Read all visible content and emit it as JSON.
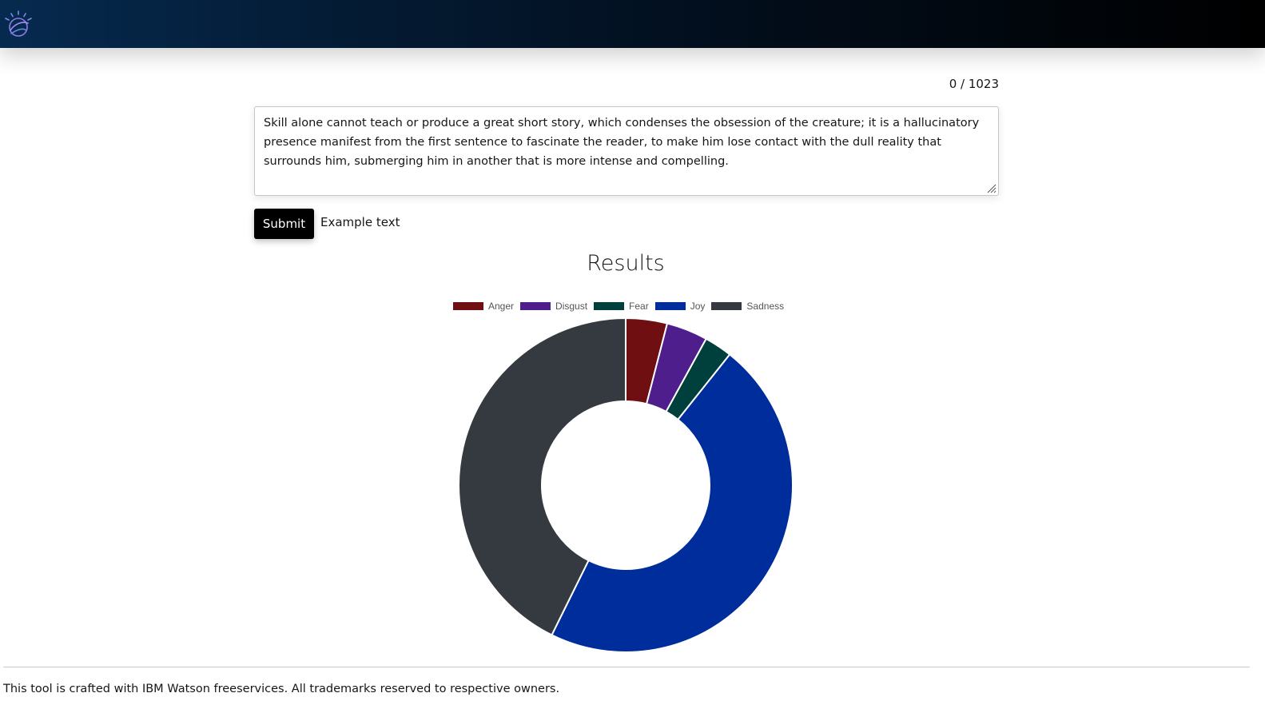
{
  "header": {
    "logo_icon": "ibm-watson-logo-icon"
  },
  "counter": "0 / 1023",
  "input": {
    "value": "Skill alone cannot teach or produce a great short story, which condenses the obsession of the creature; it is a hallucinatory presence manifest from the first sentence to fascinate the reader, to make him lose contact with the dull reality that surrounds him, submerging him in another that is more intense and compelling."
  },
  "actions": {
    "submit_label": "Submit",
    "example_label": "Example text"
  },
  "results": {
    "title": "Results"
  },
  "chart_data": {
    "type": "pie",
    "variant": "doughnut",
    "labels": [
      "Anger",
      "Disgust",
      "Fear",
      "Joy",
      "Sadness"
    ],
    "values": [
      0.04,
      0.04,
      0.027,
      0.466,
      0.427
    ],
    "colors": [
      "#6f0f12",
      "#4d1e8c",
      "#00403c",
      "#002d9c",
      "#343a40"
    ],
    "legend_position": "top"
  },
  "footer": {
    "text": "This tool is crafted with IBM Watson freeservices. All trademarks reserved to respective owners."
  }
}
